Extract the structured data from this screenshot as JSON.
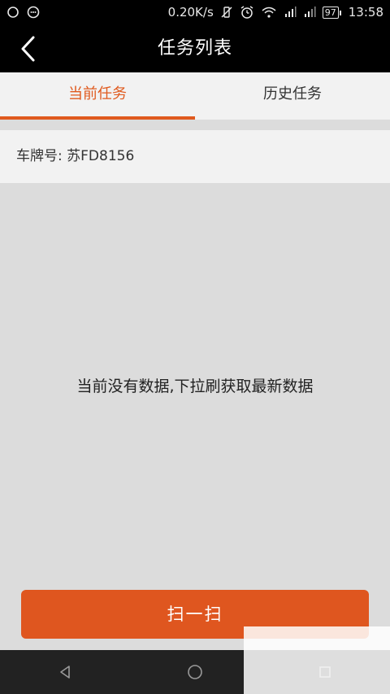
{
  "status_bar": {
    "speed": "0.20K/s",
    "battery": "97",
    "time": "13:58"
  },
  "header": {
    "title": "任务列表"
  },
  "tabs": [
    {
      "label": "当前任务",
      "active": true
    },
    {
      "label": "历史任务",
      "active": false
    }
  ],
  "plate": {
    "text": "车牌号: 苏FD8156"
  },
  "main": {
    "empty_message": "当前没有数据,下拉刷获取最新数据"
  },
  "actions": {
    "scan_label": "扫一扫"
  },
  "colors": {
    "accent": "#e05a1e",
    "button": "#df561f",
    "background": "#dcdcdc"
  }
}
